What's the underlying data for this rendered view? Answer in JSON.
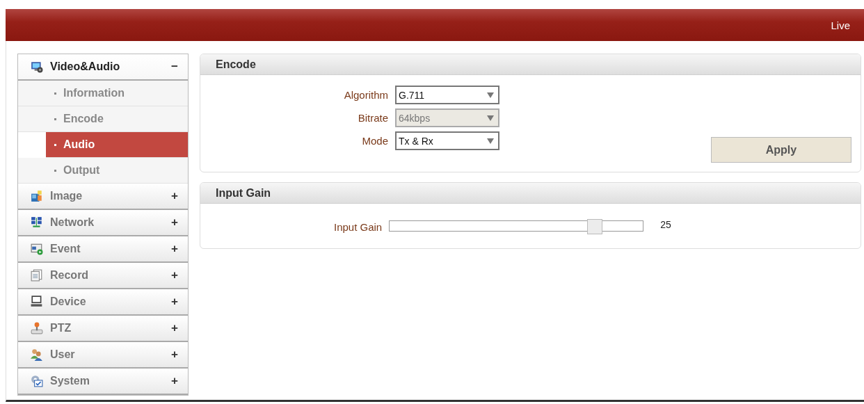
{
  "header": {
    "live_link": "Live"
  },
  "sidebar": {
    "groups": [
      {
        "label": "Video&Audio",
        "expanded": true,
        "toggle": "−",
        "children": [
          {
            "label": "Information",
            "selected": false
          },
          {
            "label": "Encode",
            "selected": false
          },
          {
            "label": "Audio",
            "selected": true
          },
          {
            "label": "Output",
            "selected": false
          }
        ]
      },
      {
        "label": "Image",
        "expanded": false,
        "toggle": "+"
      },
      {
        "label": "Network",
        "expanded": false,
        "toggle": "+"
      },
      {
        "label": "Event",
        "expanded": false,
        "toggle": "+"
      },
      {
        "label": "Record",
        "expanded": false,
        "toggle": "+"
      },
      {
        "label": "Device",
        "expanded": false,
        "toggle": "+"
      },
      {
        "label": "PTZ",
        "expanded": false,
        "toggle": "+"
      },
      {
        "label": "User",
        "expanded": false,
        "toggle": "+"
      },
      {
        "label": "System",
        "expanded": false,
        "toggle": "+"
      }
    ]
  },
  "encode": {
    "title": "Encode",
    "fields": [
      {
        "label": "Algorithm",
        "value": "G.711",
        "disabled": false
      },
      {
        "label": "Bitrate",
        "value": "64kbps",
        "disabled": true
      },
      {
        "label": "Mode",
        "value": "Tx & Rx",
        "disabled": false
      }
    ],
    "apply_button": "Apply"
  },
  "input_gain": {
    "title": "Input Gain",
    "label": "Input Gain",
    "level": 0.81,
    "reading": "25"
  }
}
